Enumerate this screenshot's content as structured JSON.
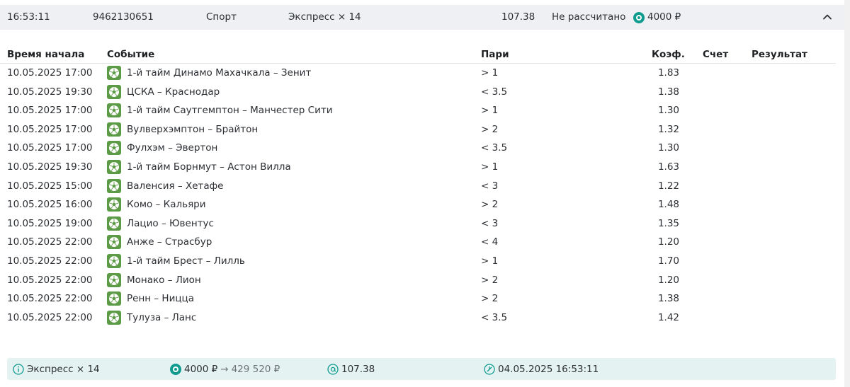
{
  "header": {
    "time": "16:53:11",
    "bet_id": "9462130651",
    "sport": "Спорт",
    "bet_type": "Экспресс × 14",
    "coef": "107.38",
    "status": "Не рассчитано",
    "amount": "4000 ₽"
  },
  "table": {
    "columns": {
      "time": "Время начала",
      "event": "Событие",
      "pari": "Пари",
      "coef": "Коэф.",
      "score": "Счет",
      "result": "Результат"
    },
    "rows": [
      {
        "time": "10.05.2025 17:00",
        "event": "1-й тайм Динамо Махачкала – Зенит",
        "pari": "> 1",
        "coef": "1.83"
      },
      {
        "time": "10.05.2025 19:30",
        "event": "ЦСКА – Краснодар",
        "pari": "< 3.5",
        "coef": "1.38"
      },
      {
        "time": "10.05.2025 17:00",
        "event": "1-й тайм Саутгемптон – Манчестер Сити",
        "pari": "> 1",
        "coef": "1.30"
      },
      {
        "time": "10.05.2025 17:00",
        "event": "Вулверхэмптон – Брайтон",
        "pari": "> 2",
        "coef": "1.32"
      },
      {
        "time": "10.05.2025 17:00",
        "event": "Фулхэм – Эвертон",
        "pari": "< 3.5",
        "coef": "1.30"
      },
      {
        "time": "10.05.2025 19:30",
        "event": "1-й тайм Борнмут – Астон Вилла",
        "pari": "> 1",
        "coef": "1.63"
      },
      {
        "time": "10.05.2025 15:00",
        "event": "Валенсия – Хетафе",
        "pari": "< 3",
        "coef": "1.22"
      },
      {
        "time": "10.05.2025 16:00",
        "event": "Комо – Кальяри",
        "pari": "> 2",
        "coef": "1.48"
      },
      {
        "time": "10.05.2025 19:00",
        "event": "Лацио – Ювентус",
        "pari": "< 3",
        "coef": "1.35"
      },
      {
        "time": "10.05.2025 22:00",
        "event": "Анже – Страсбур",
        "pari": "< 4",
        "coef": "1.20"
      },
      {
        "time": "10.05.2025 22:00",
        "event": "1-й тайм Брест – Лилль",
        "pari": "> 1",
        "coef": "1.70"
      },
      {
        "time": "10.05.2025 22:00",
        "event": "Монако – Лион",
        "pari": "> 2",
        "coef": "1.20"
      },
      {
        "time": "10.05.2025 22:00",
        "event": "Ренн – Ницца",
        "pari": "> 2",
        "coef": "1.38"
      },
      {
        "time": "10.05.2025 22:00",
        "event": "Тулуза – Ланс",
        "pari": "< 3.5",
        "coef": "1.42"
      }
    ]
  },
  "footer": {
    "bet_type": "Экспресс × 14",
    "amount": "4000 ₽",
    "arrow": "→",
    "payout": "429 520 ₽",
    "coef": "107.38",
    "date": "04.05.2025 16:53:11"
  },
  "icons": {
    "sport": "soccer-ball-icon",
    "currency": "coin-icon",
    "info": "info-icon",
    "coef": "at-icon",
    "date": "clock-icon",
    "collapse": "chevron-up-icon"
  },
  "colors": {
    "accent": "#0f9b8e",
    "sport_icon_bg": "#5c9b45",
    "header_bg": "#eef0f3",
    "footer_bg": "#e4f3f2"
  }
}
